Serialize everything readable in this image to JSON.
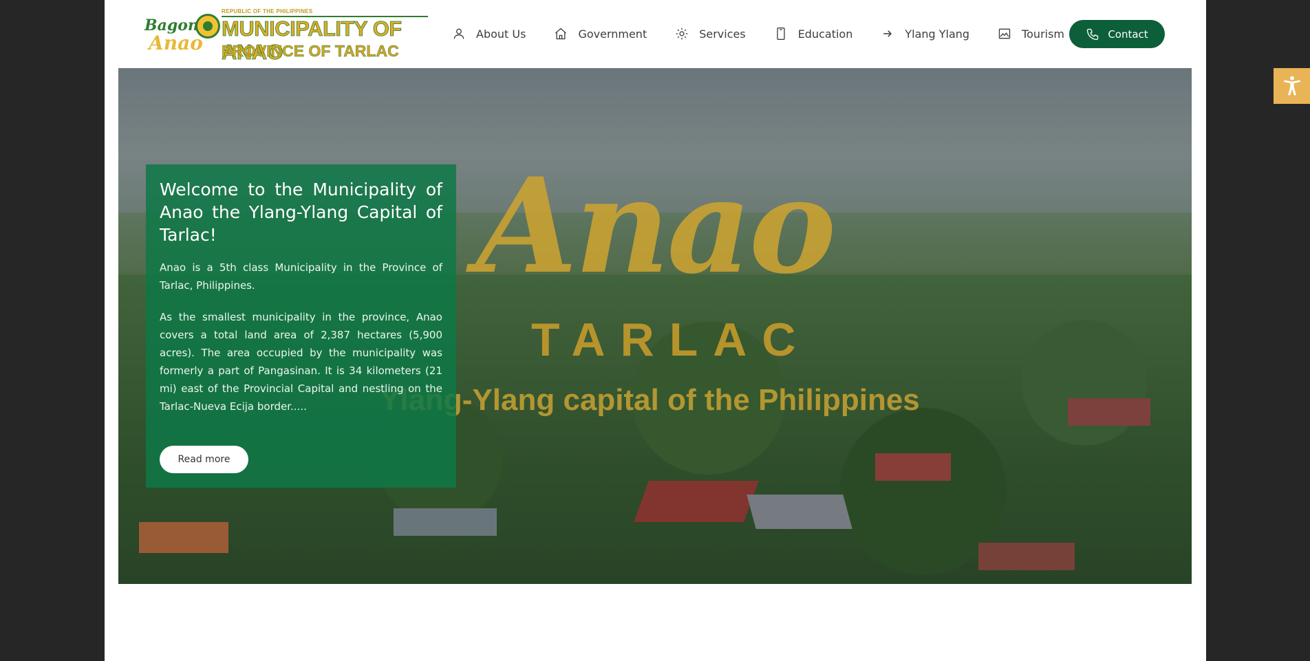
{
  "logo": {
    "republic": "REPUBLIC OF THE PHILIPPINES",
    "bagong": "Bagong",
    "anao": "Anao",
    "municipality": "MUNICIPALITY OF ANAO",
    "province": "PROVINCE OF TARLAC"
  },
  "nav": {
    "items": [
      {
        "label": "About Us",
        "icon": "user-icon"
      },
      {
        "label": "Government",
        "icon": "home-icon"
      },
      {
        "label": "Services",
        "icon": "gear-icon"
      },
      {
        "label": "Education",
        "icon": "tablet-icon"
      },
      {
        "label": "Ylang Ylang",
        "icon": "arrow-right-icon"
      },
      {
        "label": "Tourism",
        "icon": "image-icon"
      }
    ],
    "contact_label": "Contact",
    "contact_icon": "phone-icon"
  },
  "hero": {
    "overlay_title": "Anao",
    "overlay_subtitle": "TARLAC",
    "overlay_tagline": "Ylang-Ylang capital of the Philippines",
    "card_title": "Welcome to the Municipality of Anao the Ylang-Ylang Capital of Tarlac!",
    "card_paragraph_1": "Anao is a 5th class Municipality in the Province of Tarlac, Philippines.",
    "card_paragraph_2": "As the smallest municipality in the province, Anao covers a total land area of 2,387 hectares (5,900 acres). The area occupied by the municipality was formerly a part of Pangasinan. It is 34 kilometers (21 mi) east of the Provincial Capital and nestling on the Tarlac-Nueva Ecija border.....",
    "read_more_label": "Read more"
  },
  "accessibility": {
    "icon": "accessibility-icon"
  },
  "colors": {
    "brand_green": "#0d5f3a",
    "card_green": "#0e7846",
    "accent_gold": "#e8b455",
    "background": "#262626"
  }
}
